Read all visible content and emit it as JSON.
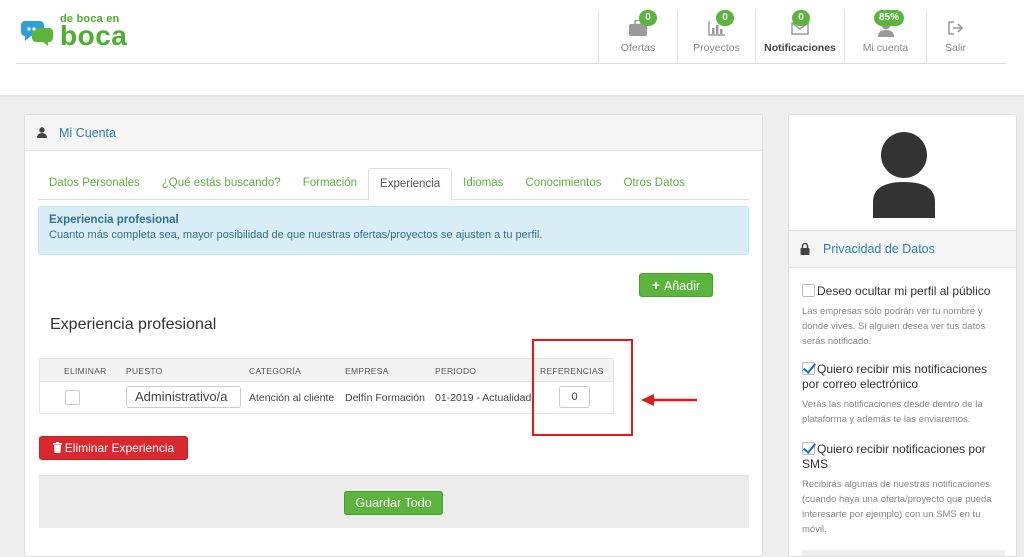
{
  "brand": {
    "line1": "de boca en",
    "line2": "boca",
    "color": "#4caf2f"
  },
  "nav": [
    {
      "icon": "briefcase-icon",
      "label": "Ofertas",
      "badge": "0"
    },
    {
      "icon": "bar-chart-icon",
      "label": "Proyectos",
      "badge": "0"
    },
    {
      "icon": "envelope-icon",
      "label": "Notificaciones",
      "badge": "0"
    },
    {
      "icon": "user-icon",
      "label": "Mi cuenta",
      "badge": "85%"
    },
    {
      "icon": "sign-out-icon",
      "label": "Salir"
    }
  ],
  "panel": {
    "title": "Mi Cuenta",
    "tabs": [
      "Datos Personales",
      "¿Qué estás buscando?",
      "Formación",
      "Experiencia",
      "Idiomas",
      "Conocimientos",
      "Otros Datos"
    ],
    "active_tab": "Experiencia",
    "alert": {
      "heading": "Experiencia profesional",
      "text": "Cuanto más completa sea, mayor posibilidad de que nuestras ofertas/proyectos se ajusten a tu perfil."
    },
    "add_button": "Añadir",
    "section_title": "Experiencia profesional",
    "table": {
      "headers": [
        "ELIMINAR",
        "PUESTO",
        "CATEGORÍA",
        "EMPRESA",
        "PERIODO",
        "REFERENCIAS"
      ],
      "rows": [
        {
          "puesto": "Administrativo/a",
          "categoria": "Atención al cliente",
          "empresa": "Delfín Formación",
          "periodo": "01-2019 - Actualidad",
          "referencias": "0"
        }
      ]
    },
    "delete_button": "Eliminar Experiencia",
    "save_button": "Guardar Todo"
  },
  "privacy": {
    "title": "Privacidad de Datos",
    "options": [
      {
        "label": "Deseo ocultar mi perfil al público",
        "checked": false,
        "desc": "Las empresas sólo podrán ver tu nombre y donde vives. Si alguien desea ver tus datos serás notificado."
      },
      {
        "label": "Quiero recibir mis notificaciones por correo electrónico",
        "checked": true,
        "desc": "Verás las notificaciones desde dentro de la plataforma y además te las enviaremos."
      },
      {
        "label": "Quiero recibir notificaciones por SMS",
        "checked": true,
        "desc": "Recibirás algunas de nuestras notificaciones (cuando haya una oferta/proyecto que pueda interesarte por ejemplo) con un SMS en tu móvil."
      }
    ]
  },
  "colors": {
    "green": "#5bb53c",
    "link_blue": "#2f7fb4",
    "danger": "#d9292f",
    "info_bg": "#d9edf7",
    "annotation_red": "#e01a1a"
  }
}
